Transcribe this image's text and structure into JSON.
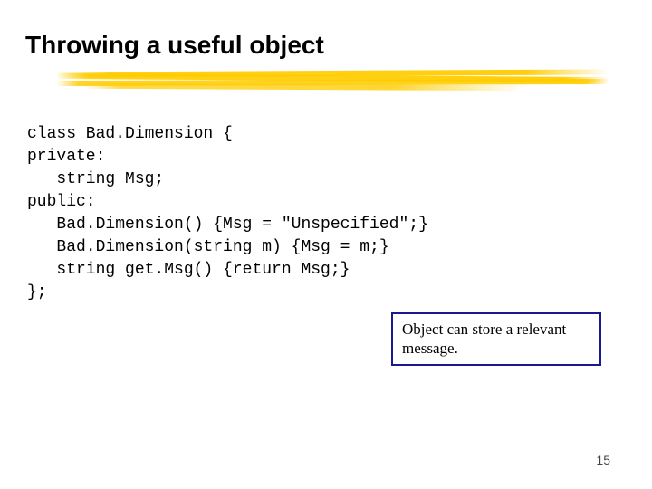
{
  "title": "Throwing a useful object",
  "code": "class Bad.Dimension {\nprivate:\n   string Msg;\npublic:\n   Bad.Dimension() {Msg = \"Unspecified\";}\n   Bad.Dimension(string m) {Msg = m;}\n   string get.Msg() {return Msg;}\n};",
  "callout": "Object can store a relevant message.",
  "pageNumber": "15"
}
